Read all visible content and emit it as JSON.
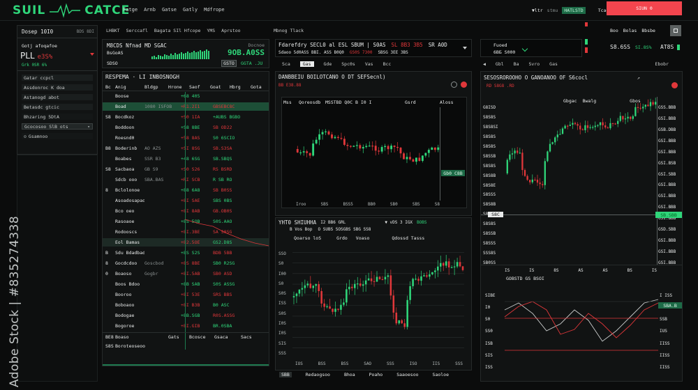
{
  "header": {
    "logo_left": "SUIL",
    "logo_right": "CATCE",
    "nav": [
      "Fatge",
      "Arnb",
      "Gatse",
      "Gatly",
      "Mdfrope"
    ],
    "status_left": "▼ltr",
    "status_mid": "stmu",
    "status_badge": "HATLSTD",
    "status_right": "Tcad",
    "action_label": "SIUN 0"
  },
  "sidebar": {
    "title": "Dosep 10I0",
    "title_right": "BDS 8DI",
    "line1": "Gotj afoqafoe",
    "pl_label": "PLL",
    "pl_value": "е3S%",
    "line2": "Grk 0SR 6%",
    "items": [
      "Gatar ccpcl",
      "Assdonroc K doa",
      "Astanogd abot",
      "Betasdc gtcic",
      "Bhzaring 5DtA",
      "Gcocosoo SlB ots",
      "Gsamnoo"
    ]
  },
  "watchlist_header": {
    "tab1": "LHBKT",
    "tab2": "Serccafl",
    "tab3": "Bagata SIl Hfcope",
    "tab4": "YMS",
    "tab5": "Aprstoo",
    "tab6": "Mbnog Tlack"
  },
  "summary": {
    "title": "M8CDS Nfnad MD SGAC",
    "title_right": "Docnoe",
    "sub": "BsGoAS",
    "big_value": "9OB.A0SS",
    "small_left": "SDSO",
    "btn1": "GSTO",
    "btn2": "GGTA .JU"
  },
  "table": {
    "title": "RESPEMA · LI INBOSNOGH",
    "headers": [
      "Bc",
      "Anig",
      "Bldgp",
      "Hrone",
      "Saof",
      "Goat",
      "Hbrg",
      "Gota"
    ],
    "rows": [
      {
        "a": "",
        "b": "Boose",
        "c": "",
        "d": "+68 405",
        "e": "",
        "f": "",
        "cls": ""
      },
      {
        "a": "",
        "b": "Boad",
        "c": "1080 ISFOB",
        "d": "+R1.2I1",
        "e": "GBSEBC8C",
        "f": "",
        "cls": "hl"
      },
      {
        "a": "S8",
        "b": "Bocdkoz",
        "c": "",
        "d": "+S0 1IA",
        "e": "+AUBS BGBO",
        "f": "",
        "cls": ""
      },
      {
        "a": "",
        "b": "Boddoon",
        "c": "",
        "d": "+S8 8BE",
        "e": "SB OD22",
        "f": "",
        "cls": ""
      },
      {
        "a": "",
        "b": "Roesnd0",
        "c": "",
        "d": "+58 8AS",
        "e": "S0 6SCIO",
        "f": "",
        "cls": ""
      },
      {
        "a": "B8",
        "b": "Boderinb",
        "c": "AO AZS",
        "d": "+SI 8SG",
        "e": "SB.S3SA",
        "f": "",
        "cls": ""
      },
      {
        "a": "",
        "b": "Boabes",
        "c": "SSR B3",
        "d": "+48 6SG",
        "e": "SB.SBQS",
        "f": "",
        "cls": ""
      },
      {
        "a": "S8",
        "b": "Sacbaoa",
        "c": "GB S9",
        "d": "+S0 S26",
        "e": "RS BSRD",
        "f": "",
        "cls": ""
      },
      {
        "a": "",
        "b": "Sdcb ooo",
        "c": "SBA.BAS",
        "d": "+RI SCB",
        "e": "R SB RO",
        "f": "",
        "cls": ""
      },
      {
        "a": "8",
        "b": "Bclolonoe",
        "c": "",
        "d": "+88 6A8",
        "e": "SB B0SS",
        "f": "",
        "cls": ""
      },
      {
        "a": "",
        "b": "Asoadosapao",
        "c": "",
        "d": "+8I SAE",
        "e": "SBS 0BS",
        "f": "",
        "cls": ""
      },
      {
        "a": "",
        "b": "Bco oeo",
        "c": "",
        "d": "+8I 8AB",
        "e": "GB.OB0S",
        "f": "",
        "cls": ""
      },
      {
        "a": "",
        "b": "Rasoaoe",
        "c": "",
        "d": "+8S 5QB",
        "e": "S0S.AAO",
        "f": "",
        "cls": ""
      },
      {
        "a": "",
        "b": "Rodooscs",
        "c": "",
        "d": "+8I.3BE",
        "e": "SA S0SG",
        "f": "",
        "cls": ""
      },
      {
        "a": "",
        "b": "Eol Bamas",
        "c": "",
        "d": "+82.5OE",
        "e": "GS2.D8S",
        "f": "",
        "cls": "sel"
      },
      {
        "a": "B",
        "b": "Sdu Bdadbad",
        "c": "",
        "d": "+8S S2S",
        "e": "BDB 5BB",
        "f": "",
        "cls": ""
      },
      {
        "a": "8",
        "b": "Gocdcdoo",
        "c": "Goscbod",
        "d": "+8S 8BE",
        "e": "SB0 R2SG",
        "f": "",
        "cls": ""
      },
      {
        "a": "0",
        "b": "Boaoso",
        "c": "Gogbr",
        "d": "+8I.5AB",
        "e": "SB0 ASD",
        "f": "",
        "cls": ""
      },
      {
        "a": "",
        "b": "Boos Bdoo",
        "c": "",
        "d": "+8B SAB",
        "e": "S0S ASSG",
        "f": "",
        "cls": ""
      },
      {
        "a": "",
        "b": "Booroo",
        "c": "",
        "d": "+8I 53E",
        "e": "SRS BBS",
        "f": "",
        "cls": ""
      },
      {
        "a": "",
        "b": "Boboaoo",
        "c": "",
        "d": "+8I B3B",
        "e": "B0 ASC",
        "f": "",
        "cls": ""
      },
      {
        "a": "",
        "b": "Bodogae",
        "c": "",
        "d": "+8B.SGB",
        "e": "R0S.ASSG",
        "f": "",
        "cls": ""
      },
      {
        "a": "",
        "b": "Bogoroe",
        "c": "",
        "d": "+8I.GIB",
        "e": "BR.0SBA",
        "f": "",
        "cls": ""
      }
    ],
    "footer_left": "BE8",
    "footer_mid": "Boaso",
    "footer_a": "Gats",
    "footer_b": "Bcosce",
    "footer_c": "Gsaca",
    "footer_d": "Sacs",
    "last_row_left": "S8S",
    "last_row_label": "Boroteoseoo"
  },
  "top_strip": {
    "title": "Fdarefdry SECL0 al ESL SBUM | S0AS",
    "title_red": "SL 8B3 3B5",
    "title_right": "SR A0D",
    "sub": "Sdaoo 5d0ASS BBI. ASS B0Q0",
    "sub_red": "GS0S 7300",
    "sub_right": "SBSG 3EE 3BS",
    "tabs": [
      "Sca",
      "Gas",
      "Gde",
      "Spc0s",
      "Vas",
      "Bcc"
    ]
  },
  "chart_a": {
    "title": "DANBBEIU BOILOTCANO O DT SEFSecnl)",
    "sub_red": "BB E38.88",
    "header_left": "Qoreosdb",
    "header_mid": "MSSTBD  Q0C B  I0 I",
    "header_right1": "Gsrd",
    "header_right2": "Aloss",
    "label_left": "Mss",
    "price_label": "Gb0 C8B",
    "x_ticks": [
      "Iroo",
      "SBS",
      "BSS5",
      "BB0",
      "SB0",
      "SBS",
      "S8"
    ]
  },
  "chart_b": {
    "title": "YHT0 SHIUHHA",
    "title_mid": "I2 BB6 GRL",
    "title_right1": "▼ vDS 3 IGX",
    "title_right2": "BOBS",
    "sub": "B Vos Bop",
    "sub_mid": "O SUBS SOSGBS  SBG SS8",
    "hdr": [
      "Qoarso loS",
      "Grdo",
      "Voaso",
      "Qdossd Tasss"
    ],
    "y_ticks": [
      "SSO",
      "S0",
      "I00",
      "S0",
      "S0S",
      "ISS",
      "S0S",
      "I0S",
      "I0S",
      "SIS",
      "SSS"
    ],
    "x_ticks": [
      "IOS",
      "BSS",
      "BSS",
      "SAO",
      "SSS",
      "ISO",
      "IIS",
      "SSS"
    ],
    "footer": [
      "SBB",
      "Redaogsoo",
      "Bhoa",
      "Poaho",
      "Saaoesoo",
      "Saoloe"
    ]
  },
  "right_top": {
    "a_title": "Fuoed",
    "a_sub": "6ВБ S000",
    "b_labels": [
      "Boo",
      "Bolas",
      "Bbsbe"
    ],
    "b_value": "S8.6SS",
    "b_pct": "SI.8S%",
    "b_right": "AT8S"
  },
  "chart_c": {
    "toolbar": [
      "Gbl",
      "Ba",
      "Svro",
      "Gas"
    ],
    "toolbar_right": "Ebobr",
    "title": "SESOSROROOHO O GANOANOO OF S6cocl",
    "sub_red": "RD S8G8 .RD",
    "header": [
      "Gbgac",
      "Bwalg",
      "Gbos"
    ],
    "y_left": [
      "G8ISD",
      "S8S8S",
      "S8S8SI",
      "S8S8S",
      "S8S8S",
      "S8SSB",
      "S8S8S",
      "S8S8B",
      "S8S8E",
      "S8SSS",
      "S8S8B",
      "S8S8S",
      "S8S8S",
      "S8SSB",
      "S8SSS",
      "SSS8S",
      "SB0SS"
    ],
    "y_right": [
      "GSS.BBB",
      "GSI.BBB",
      "GSB.DBB",
      "GSI.BBB",
      "GSI.BBB",
      "GSI.BSB",
      "GSI.SBB",
      "GSI.BBB",
      "GSI.BBB",
      "GSI.BBB",
      "GSI.BBB",
      "GSD.SBB",
      "GSI.BBB",
      "GSI.BBB",
      "GSI.BBB"
    ],
    "marker": "SB.SBB",
    "left_marker": "S8C"
  },
  "chart_d": {
    "title": "GOBSTD GS BSOI",
    "x_ticks": [
      "IS",
      "IS",
      "8S",
      "AS",
      "AS",
      "BS",
      "IS"
    ],
    "y_left": [
      "SIBE",
      "I0",
      "S0",
      "SS0",
      "ISB",
      "SIS",
      "ISS"
    ],
    "y_right": [
      "I ISS",
      "I ISS",
      "SSB",
      "IUS",
      "IISS",
      "IISS",
      "IISS"
    ],
    "tag": "SBA.B"
  },
  "watermark": {
    "vertical": "Adobe Stock | #835274338"
  },
  "colors": {
    "green": "#2fd67a",
    "red": "#e0373a",
    "accent_button": "#f3454e"
  }
}
